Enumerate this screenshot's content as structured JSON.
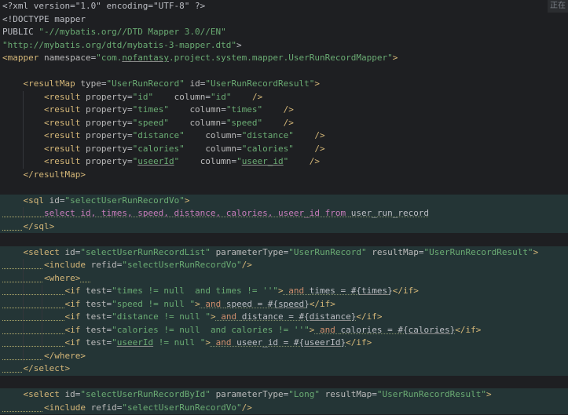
{
  "status_badge": "正在",
  "lines": [
    [
      [
        "pi",
        "<?xml version=\"1.0\" encoding=\"UTF-8\" ?>"
      ]
    ],
    [
      [
        "dtd",
        "<!DOCTYPE mapper"
      ]
    ],
    [
      [
        "dtd",
        "PUBLIC "
      ],
      [
        "str",
        "\"-//mybatis.org//DTD Mapper 3.0//EN\""
      ]
    ],
    [
      [
        "str",
        "\"http://mybatis.org/dtd/mybatis-3-mapper.dtd\""
      ],
      [
        "dtd",
        ">"
      ]
    ],
    [
      [
        "tag",
        "<mapper "
      ],
      [
        "attr",
        "namespace"
      ],
      [
        "plain",
        "="
      ],
      [
        "str",
        "\"com."
      ],
      [
        "str ul",
        "nofantasy"
      ],
      [
        "str",
        ".project.system.mapper.UserRunRecordMapper\""
      ],
      [
        "tag",
        ">"
      ]
    ],
    [],
    [
      [
        "plain",
        "    "
      ],
      [
        "tag",
        "<resultMap "
      ],
      [
        "attr",
        "type"
      ],
      [
        "plain",
        "="
      ],
      [
        "str",
        "\"UserRunRecord\""
      ],
      [
        "plain",
        " "
      ],
      [
        "attr",
        "id"
      ],
      [
        "plain",
        "="
      ],
      [
        "str",
        "\"UserRunRecordResult\""
      ],
      [
        "tag",
        ">"
      ]
    ],
    [
      [
        "plain",
        "        "
      ],
      [
        "tag",
        "<result "
      ],
      [
        "attr",
        "property"
      ],
      [
        "plain",
        "="
      ],
      [
        "str",
        "\"id\""
      ],
      [
        "plain",
        "    "
      ],
      [
        "attr",
        "column"
      ],
      [
        "plain",
        "="
      ],
      [
        "str",
        "\"id\""
      ],
      [
        "plain",
        "    "
      ],
      [
        "tag",
        "/>"
      ]
    ],
    [
      [
        "plain",
        "        "
      ],
      [
        "tag",
        "<result "
      ],
      [
        "attr",
        "property"
      ],
      [
        "plain",
        "="
      ],
      [
        "str",
        "\"times\""
      ],
      [
        "plain",
        "    "
      ],
      [
        "attr",
        "column"
      ],
      [
        "plain",
        "="
      ],
      [
        "str",
        "\"times\""
      ],
      [
        "plain",
        "    "
      ],
      [
        "tag",
        "/>"
      ]
    ],
    [
      [
        "plain",
        "        "
      ],
      [
        "tag",
        "<result "
      ],
      [
        "attr",
        "property"
      ],
      [
        "plain",
        "="
      ],
      [
        "str",
        "\"speed\""
      ],
      [
        "plain",
        "    "
      ],
      [
        "attr",
        "column"
      ],
      [
        "plain",
        "="
      ],
      [
        "str",
        "\"speed\""
      ],
      [
        "plain",
        "    "
      ],
      [
        "tag",
        "/>"
      ]
    ],
    [
      [
        "plain",
        "        "
      ],
      [
        "tag",
        "<result "
      ],
      [
        "attr",
        "property"
      ],
      [
        "plain",
        "="
      ],
      [
        "str",
        "\"distance\""
      ],
      [
        "plain",
        "    "
      ],
      [
        "attr",
        "column"
      ],
      [
        "plain",
        "="
      ],
      [
        "str",
        "\"distance\""
      ],
      [
        "plain",
        "    "
      ],
      [
        "tag",
        "/>"
      ]
    ],
    [
      [
        "plain",
        "        "
      ],
      [
        "tag",
        "<result "
      ],
      [
        "attr",
        "property"
      ],
      [
        "plain",
        "="
      ],
      [
        "str",
        "\"calories\""
      ],
      [
        "plain",
        "    "
      ],
      [
        "attr",
        "column"
      ],
      [
        "plain",
        "="
      ],
      [
        "str",
        "\"calories\""
      ],
      [
        "plain",
        "    "
      ],
      [
        "tag",
        "/>"
      ]
    ],
    [
      [
        "plain",
        "        "
      ],
      [
        "tag",
        "<result "
      ],
      [
        "attr",
        "property"
      ],
      [
        "plain",
        "="
      ],
      [
        "str",
        "\""
      ],
      [
        "str ul",
        "useerId"
      ],
      [
        "str",
        "\""
      ],
      [
        "plain",
        "    "
      ],
      [
        "attr",
        "column"
      ],
      [
        "plain",
        "="
      ],
      [
        "str",
        "\""
      ],
      [
        "str ul",
        "useer_id"
      ],
      [
        "str",
        "\""
      ],
      [
        "plain",
        "    "
      ],
      [
        "tag",
        "/>"
      ]
    ],
    [
      [
        "plain",
        "    "
      ],
      [
        "tag",
        "</resultMap>"
      ]
    ],
    [],
    [
      [
        "plain",
        "    "
      ],
      [
        "tag",
        "<sql "
      ],
      [
        "attr",
        "id"
      ],
      [
        "plain",
        "="
      ],
      [
        "str",
        "\"selectUserRunRecordVo\""
      ],
      [
        "tag",
        ">"
      ]
    ],
    [
      [
        "ws",
        "        "
      ],
      [
        "col sq",
        "select id, times, speed, distance, calories, useer_id from "
      ],
      [
        "plain sq",
        "user_run_record"
      ]
    ],
    [
      [
        "ws",
        "    "
      ],
      [
        "tag",
        "</sql>"
      ]
    ],
    [],
    [
      [
        "plain",
        "    "
      ],
      [
        "tag",
        "<select "
      ],
      [
        "attr",
        "id"
      ],
      [
        "plain",
        "="
      ],
      [
        "str",
        "\"selectUserRunRecordList\""
      ],
      [
        "plain",
        " "
      ],
      [
        "attr",
        "parameterType"
      ],
      [
        "plain",
        "="
      ],
      [
        "str",
        "\"UserRunRecord\""
      ],
      [
        "plain",
        " "
      ],
      [
        "attr",
        "resultMap"
      ],
      [
        "plain",
        "="
      ],
      [
        "str",
        "\"UserRunRecordResult\""
      ],
      [
        "tag",
        ">"
      ]
    ],
    [
      [
        "ws",
        "        "
      ],
      [
        "tag",
        "<include "
      ],
      [
        "attr",
        "refid"
      ],
      [
        "plain",
        "="
      ],
      [
        "str",
        "\"selectUserRunRecordVo\""
      ],
      [
        "tag",
        "/>"
      ]
    ],
    [
      [
        "ws",
        "        "
      ],
      [
        "tag",
        "<where>"
      ],
      [
        "ws",
        "  "
      ]
    ],
    [
      [
        "ws",
        "            "
      ],
      [
        "tag",
        "<if "
      ],
      [
        "attr",
        "test"
      ],
      [
        "plain",
        "="
      ],
      [
        "str",
        "\"times != null  and times != ''\""
      ],
      [
        "tag",
        ">"
      ],
      [
        "kw sq",
        " and "
      ],
      [
        "plain sq",
        "times = #{"
      ],
      [
        "plain ul",
        "times"
      ],
      [
        "plain sq",
        "}"
      ],
      [
        "tag",
        "</if>"
      ]
    ],
    [
      [
        "ws",
        "            "
      ],
      [
        "tag",
        "<if "
      ],
      [
        "attr",
        "test"
      ],
      [
        "plain",
        "="
      ],
      [
        "str",
        "\"speed != null \""
      ],
      [
        "tag",
        ">"
      ],
      [
        "kw sq",
        " and "
      ],
      [
        "plain sq",
        "speed = #{"
      ],
      [
        "plain ul",
        "speed"
      ],
      [
        "plain sq",
        "}"
      ],
      [
        "tag",
        "</if>"
      ]
    ],
    [
      [
        "ws",
        "            "
      ],
      [
        "tag",
        "<if "
      ],
      [
        "attr",
        "test"
      ],
      [
        "plain",
        "="
      ],
      [
        "str",
        "\"distance != null \""
      ],
      [
        "tag",
        ">"
      ],
      [
        "kw sq",
        " and "
      ],
      [
        "plain sq",
        "distance = #{"
      ],
      [
        "plain ul",
        "distance"
      ],
      [
        "plain sq",
        "}"
      ],
      [
        "tag",
        "</if>"
      ]
    ],
    [
      [
        "ws",
        "            "
      ],
      [
        "tag",
        "<if "
      ],
      [
        "attr",
        "test"
      ],
      [
        "plain",
        "="
      ],
      [
        "str",
        "\"calories != null  and calories != ''\""
      ],
      [
        "tag",
        ">"
      ],
      [
        "kw sq",
        " and "
      ],
      [
        "plain sq",
        "calories = #{"
      ],
      [
        "plain ul",
        "calories"
      ],
      [
        "plain sq",
        "}"
      ],
      [
        "tag",
        "</if>"
      ]
    ],
    [
      [
        "ws",
        "            "
      ],
      [
        "tag",
        "<if "
      ],
      [
        "attr",
        "test"
      ],
      [
        "plain",
        "="
      ],
      [
        "str",
        "\""
      ],
      [
        "str ul",
        "useerId"
      ],
      [
        "str",
        " != null \""
      ],
      [
        "tag",
        ">"
      ],
      [
        "kw sq",
        " and "
      ],
      [
        "plain sq",
        "useer_id = #{"
      ],
      [
        "plain ul",
        "useerId"
      ],
      [
        "plain sq",
        "}"
      ],
      [
        "tag",
        "</if>"
      ]
    ],
    [
      [
        "ws",
        "        "
      ],
      [
        "tag",
        "</where>"
      ]
    ],
    [
      [
        "ws",
        "    "
      ],
      [
        "tag",
        "</select>"
      ]
    ],
    [],
    [
      [
        "plain",
        "    "
      ],
      [
        "tag",
        "<select "
      ],
      [
        "attr",
        "id"
      ],
      [
        "plain",
        "="
      ],
      [
        "str",
        "\"selectUserRunRecordById\""
      ],
      [
        "plain",
        " "
      ],
      [
        "attr",
        "parameterType"
      ],
      [
        "plain",
        "="
      ],
      [
        "str",
        "\"Long\""
      ],
      [
        "plain",
        " "
      ],
      [
        "attr",
        "resultMap"
      ],
      [
        "plain",
        "="
      ],
      [
        "str",
        "\"UserRunRecordResult\""
      ],
      [
        "tag",
        ">"
      ]
    ],
    [
      [
        "ws",
        "        "
      ],
      [
        "tag",
        "<include "
      ],
      [
        "attr",
        "refid"
      ],
      [
        "plain",
        "="
      ],
      [
        "str",
        "\"selectUserRunRecordVo\""
      ],
      [
        "tag",
        "/>"
      ]
    ]
  ],
  "highlighted_lines": [
    15,
    16,
    17,
    19,
    20,
    21,
    22,
    23,
    24,
    25,
    26,
    27,
    28,
    30,
    31
  ],
  "colors": {
    "background": "#1e1f22",
    "injected_highlight": "#243536",
    "tag": "#d5b778",
    "attribute": "#bababa",
    "string": "#6aab73",
    "sql_keyword": "#cf8e6d",
    "sql_column": "#c77dbb",
    "text": "#bcbec4"
  }
}
